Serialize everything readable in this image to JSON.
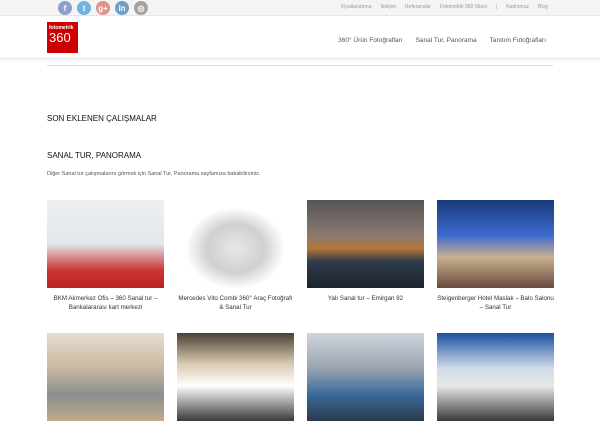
{
  "social": [
    {
      "name": "facebook",
      "glyph": "f",
      "color": "#8a9fc9"
    },
    {
      "name": "twitter",
      "glyph": "t",
      "color": "#6fb4dc"
    },
    {
      "name": "google-plus",
      "glyph": "g+",
      "color": "#e48f87"
    },
    {
      "name": "linkedin",
      "glyph": "in",
      "color": "#6e9fc4"
    },
    {
      "name": "instagram",
      "glyph": "◎",
      "color": "#a3a3a3"
    }
  ],
  "top_links": [
    "Fiyatlandırma",
    "İletişim",
    "Referanslar",
    "Fotometrik 360 Sitesi",
    "|",
    "Kadromuz",
    "Blog"
  ],
  "logo": {
    "line1": "fotometrik",
    "line2": "360"
  },
  "nav": [
    "360° Ürün Fotoğrafları",
    "Sanal Tur, Panorama",
    "Tanıtım Fotoğrafları"
  ],
  "section_title": "SON EKLENEN ÇALIŞMALAR",
  "subsection_title": "SANAL TUR, PANORAMA",
  "description": "Diğer Sanal tur çalışmalarını görmek için Sanal Tur, Panorama sayfamıza bakabilirsiniz.",
  "items": [
    {
      "caption": "BKM Akmerkez Ofis – 360 Sanal tur – Bankalararası kart merkezi",
      "bg": "linear-gradient(180deg,#f0f0f0 0%,#dfe6ea 50%,#c33 80%,#b22 100%)"
    },
    {
      "caption": "Mercedes Vito Combi 360° Araç Fotoğrafı & Sanal Tur",
      "bg": "radial-gradient(ellipse at 50% 55%,#e8e8e8 0%,#d0d0d0 35%,#fff 60%)"
    },
    {
      "caption": "Yalı Sanal tur – Emirgan 82",
      "bg": "linear-gradient(180deg,#555 0%,#8a7a70 40%,#b5773a 55%,#2f3c4c 70%,#1c232c 100%)"
    },
    {
      "caption": "Steigenberger Hotel Maslak – Balo Salonu – Sanal Tur",
      "bg": "linear-gradient(180deg,#1a3a7a 0%,#3b6ad0 40%,#c9b090 65%,#6a4a40 100%)"
    },
    {
      "caption": "",
      "bg": "linear-gradient(180deg,#e6ddd0 0%,#c8b8a0 40%,#8a8f90 70%,#c2a98a 100%)"
    },
    {
      "caption": "",
      "bg": "linear-gradient(180deg,#4a4035 0%,#d8cbb0 35%,#fff 60%,#3a3a3a 100%)"
    },
    {
      "caption": "",
      "bg": "linear-gradient(180deg,#cfd5dd 0%,#9aa4b0 40%,#3a6a9a 70%,#2a3a4a 100%)"
    },
    {
      "caption": "",
      "bg": "linear-gradient(180deg,#1a4fa0 0%,#d0dce8 40%,#e8e8e8 60%,#3a3a3a 100%)"
    }
  ]
}
